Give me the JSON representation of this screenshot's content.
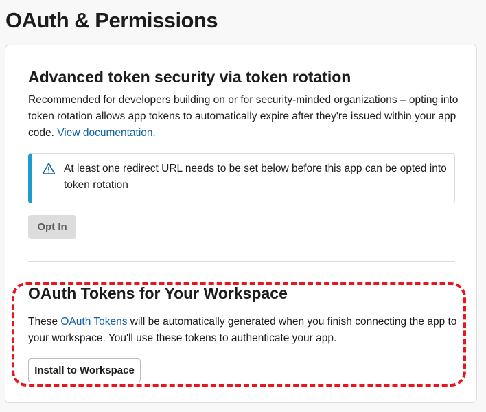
{
  "page": {
    "title": "OAuth & Permissions"
  },
  "token_rotation": {
    "title": "Advanced token security via token rotation",
    "desc_text": "Recommended for developers building on or for security-minded organizations – opting into token rotation allows app tokens to automatically expire after they're issued within your app code. ",
    "doc_link": "View documentation.",
    "alert": {
      "icon": "warning-icon",
      "text": "At least one redirect URL needs to be set below before this app can be opted into token rotation"
    },
    "opt_in_label": "Opt In"
  },
  "oauth_tokens": {
    "title": "OAuth Tokens for Your Workspace",
    "desc_prefix": "These ",
    "desc_link": "OAuth Tokens",
    "desc_suffix": " will be automatically generated when you finish connecting the app to your workspace. You'll use these tokens to authenticate your app.",
    "install_label": "Install to Workspace"
  },
  "colors": {
    "link": "#1264a3",
    "alert_accent": "#1d9bd1",
    "highlight": "#e8141e"
  }
}
